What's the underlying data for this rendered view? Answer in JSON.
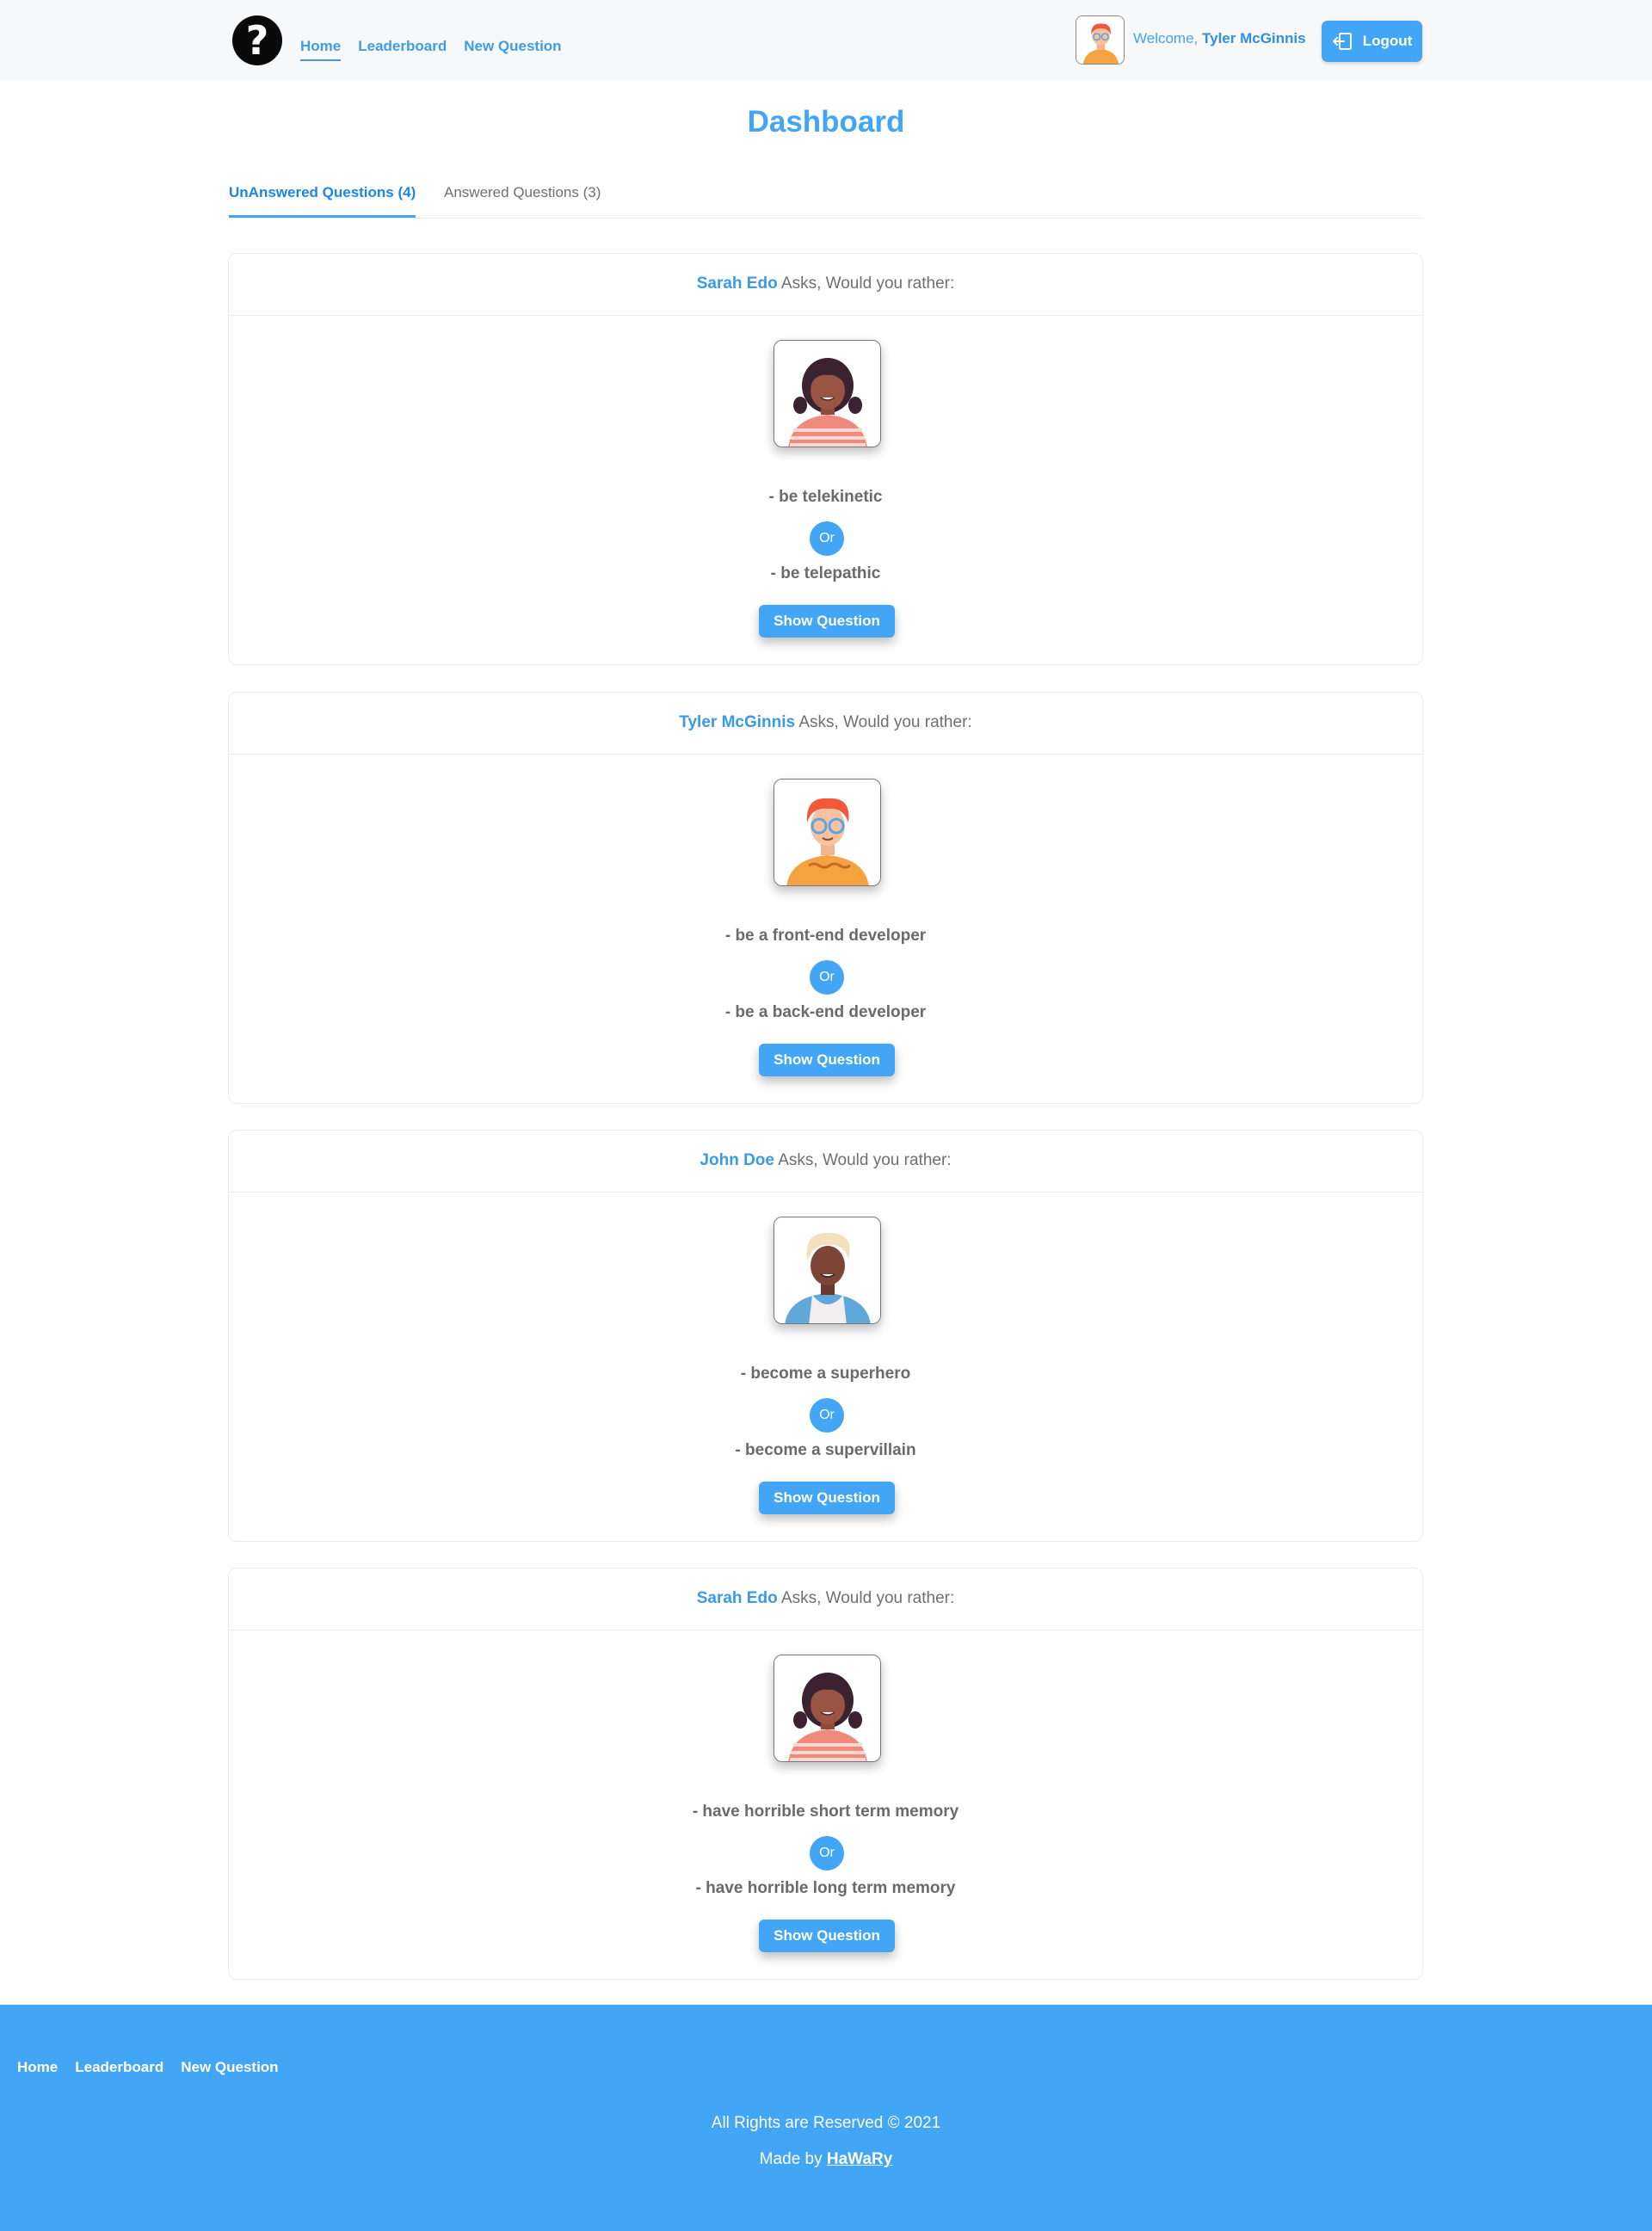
{
  "header": {
    "logo_glyph": "?",
    "nav": [
      {
        "label": "Home",
        "active": true
      },
      {
        "label": "Leaderboard",
        "active": false
      },
      {
        "label": "New Question",
        "active": false
      }
    ],
    "welcome_prefix": "Welcome,",
    "user_name": "Tyler McGinnis",
    "logout_label": "Logout",
    "logout_icon": "logout-icon"
  },
  "page": {
    "title": "Dashboard"
  },
  "tabs": [
    {
      "label": "UnAnswered Questions (4)",
      "active": true
    },
    {
      "label": "Answered Questions (3)",
      "active": false
    }
  ],
  "questions": [
    {
      "author": "Sarah Edo",
      "asks": "Asks, Would you rather:",
      "avatar": "avatar-woman-dark-hair",
      "option_one": "- be telekinetic",
      "or_label": "Or",
      "option_two": "- be telepathic",
      "button": "Show Question"
    },
    {
      "author": "Tyler McGinnis",
      "asks": "Asks, Would you rather:",
      "avatar": "avatar-man-red-hair-glasses",
      "option_one": "- be a front-end developer",
      "or_label": "Or",
      "option_two": "- be a back-end developer",
      "button": "Show Question"
    },
    {
      "author": "John Doe",
      "asks": "Asks, Would you rather:",
      "avatar": "avatar-man-blond-hair",
      "option_one": "- become a superhero",
      "or_label": "Or",
      "option_two": "- become a supervillain",
      "button": "Show Question"
    },
    {
      "author": "Sarah Edo",
      "asks": "Asks, Would you rather:",
      "avatar": "avatar-woman-dark-hair",
      "option_one": "- have horrible short term memory",
      "or_label": "Or",
      "option_two": "- have horrible long term memory",
      "button": "Show Question"
    }
  ],
  "footer": {
    "nav": [
      "Home",
      "Leaderboard",
      "New Question"
    ],
    "rights": "All Rights are Reserved © 2021",
    "made_by_prefix": "Made by",
    "made_by_name": "HaWaRy"
  },
  "colors": {
    "accent": "#42a5f5",
    "header_bg": "#f7f8f9",
    "footer_bg": "#42a5f5"
  }
}
